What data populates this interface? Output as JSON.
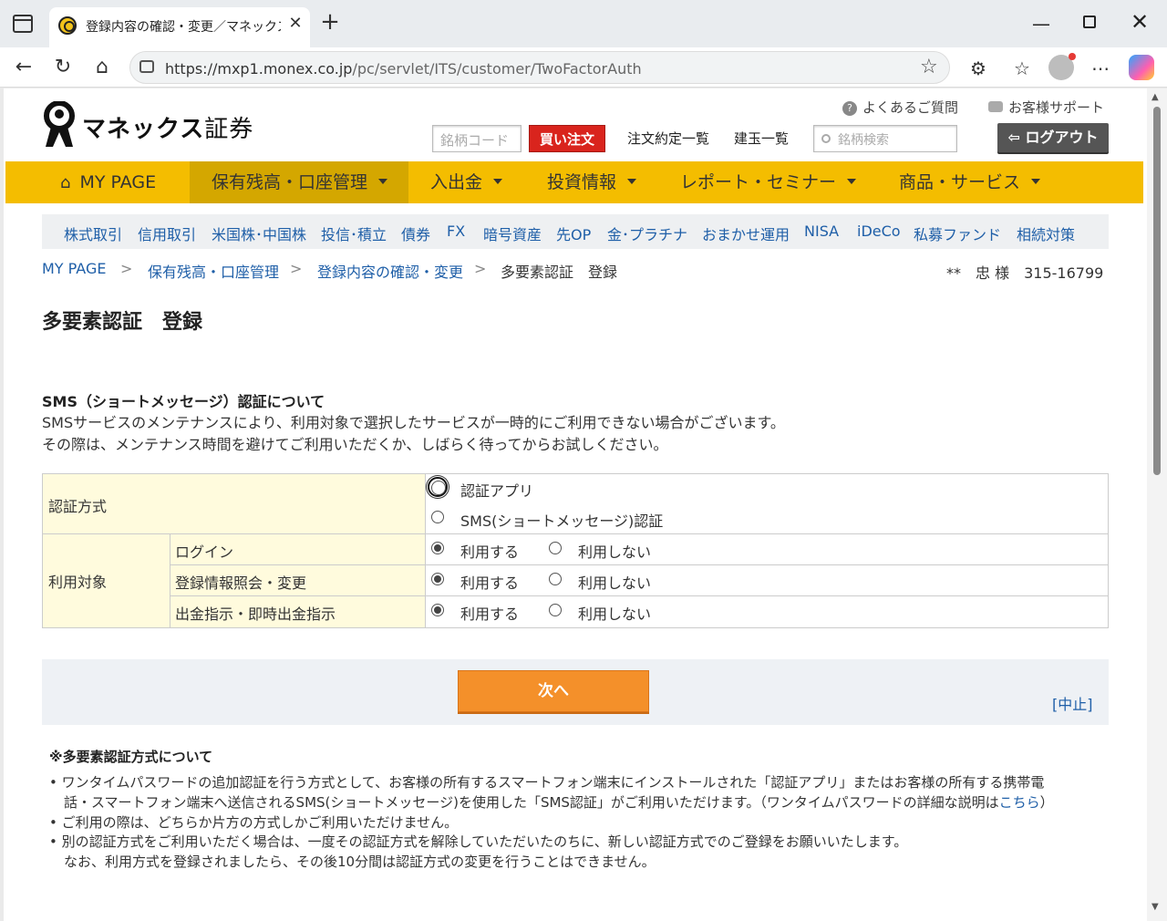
{
  "browser": {
    "tab_title": "登録内容の確認・変更／マネックス証券",
    "url_host": "https://mxp1.monex.co.jp",
    "url_path": "/pc/servlet/ITS/customer/TwoFactorAuth"
  },
  "header": {
    "logo_text": "マネックス",
    "logo_text2": "証券",
    "faq_label": "よくあるご質問",
    "support_label": "お客様サポート",
    "code_placeholder": "銘柄コード",
    "buy_label": "買い注文",
    "orders_label": "注文約定一覧",
    "positions_label": "建玉一覧",
    "search_placeholder": "銘柄検索",
    "logout_label": "ログアウト"
  },
  "mainnav": {
    "home": "MY PAGE",
    "items": [
      "保有残高・口座管理",
      "入出金",
      "投資情報",
      "レポート・セミナー",
      "商品・サービス"
    ]
  },
  "subnav": {
    "items": [
      "株式取引",
      "信用取引",
      "米国株･中国株",
      "投信･積立",
      "債券",
      "FX",
      "暗号資産",
      "先OP",
      "金･プラチナ",
      "おまかせ運用",
      "NISA",
      "iDeCo",
      "私募ファンド",
      "相続対策"
    ]
  },
  "breadcrumb": {
    "items": [
      "MY PAGE",
      "保有残高・口座管理",
      "登録内容の確認・変更"
    ],
    "separator": ">",
    "current": "多要素認証　登録"
  },
  "account": {
    "name": "**　忠 様",
    "number": "315-16799"
  },
  "page_title": "多要素認証　登録",
  "notice": {
    "heading": "SMS（ショートメッセージ）認証について",
    "lines": [
      "SMSサービスのメンテナンスにより、利用対象で選択したサービスが一時的にご利用できない場合がございます。",
      "その際は、メンテナンス時間を避けてご利用いただくか、しばらく待ってからお試しください。"
    ]
  },
  "form": {
    "method_label": "認証方式",
    "method_options": [
      "認証アプリ",
      "SMS(ショートメッセージ)認証"
    ],
    "target_label": "利用対象",
    "rows": [
      {
        "label": "ログイン",
        "use": "利用する",
        "nouse": "利用しない"
      },
      {
        "label": "登録情報照会・変更",
        "use": "利用する",
        "nouse": "利用しない"
      },
      {
        "label": "出金指示・即時出金指示",
        "use": "利用する",
        "nouse": "利用しない"
      }
    ]
  },
  "actions": {
    "next_label": "次へ",
    "cancel_label": "[中止]"
  },
  "mfa_info": {
    "heading": "※多要素認証方式について",
    "b1_line1": "ワンタイムパスワードの追加認証を行う方式として、お客様の所有するスマートフォン端末にインストールされた「認証アプリ」またはお客様の所有する携帯電",
    "b1_line2": "話・スマートフォン端末へ送信されるSMS(ショートメッセージ)を使用した「SMS認証」がご利用いただけます。（ワンタイムパスワードの詳細な説明は",
    "b1_link": "こちら",
    "b1_close": "）",
    "b2": "ご利用の際は、どちらか片方の方式しかご利用いただけません。",
    "b3_line1": "別の認証方式をご利用いただく場合は、一度その認証方式を解除していただいたのちに、新しい認証方式でのご登録をお願いいたします。",
    "b3_line2": "なお、利用方式を登録されましたら、その後10分間は認証方式の変更を行うことはできません。"
  }
}
